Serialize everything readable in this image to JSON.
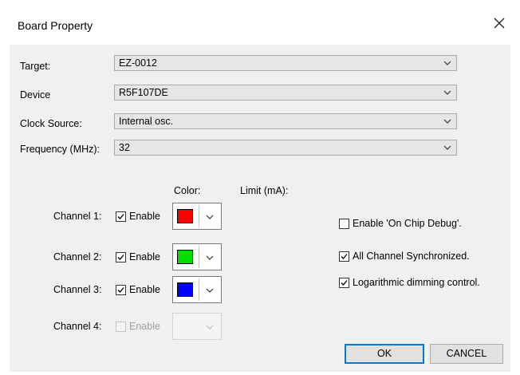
{
  "window": {
    "title": "Board Property"
  },
  "fields": {
    "target": {
      "label": "Target:",
      "value": "EZ-0012"
    },
    "device": {
      "label": "Device",
      "value": "R5F107DE"
    },
    "clock": {
      "label": "Clock Source:",
      "value": "Internal osc."
    },
    "frequency": {
      "label": "Frequency (MHz):",
      "value": "32"
    }
  },
  "headers": {
    "color": "Color:",
    "limit": "Limit (mA):"
  },
  "channels": [
    {
      "label": "Channel 1:",
      "enable_label": "Enable",
      "enabled": true,
      "checked": true,
      "color": "#ff0000"
    },
    {
      "label": "Channel 2:",
      "enable_label": "Enable",
      "enabled": true,
      "checked": true,
      "color": "#00e000"
    },
    {
      "label": "Channel 3:",
      "enable_label": "Enable",
      "enabled": true,
      "checked": true,
      "color": "#0000ff"
    },
    {
      "label": "Channel 4:",
      "enable_label": "Enable",
      "enabled": false,
      "checked": false,
      "color": ""
    }
  ],
  "options": [
    {
      "label": "Enable 'On Chip Debug'.",
      "checked": false
    },
    {
      "label": "All Channel Synchronized.",
      "checked": true
    },
    {
      "label": "Logarithmic dimming control.",
      "checked": true
    }
  ],
  "buttons": {
    "ok": "OK",
    "cancel": "CANCEL"
  },
  "icons": {
    "close": "close-icon",
    "dropdown": "chevron-down-icon",
    "check": "checkmark-icon"
  }
}
